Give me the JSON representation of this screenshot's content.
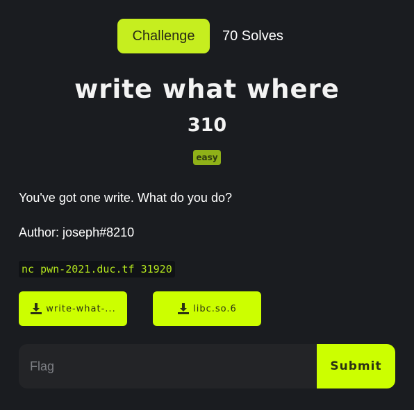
{
  "tabs": {
    "challenge_label": "Challenge",
    "solves_label": "70 Solves"
  },
  "challenge": {
    "name": "write what where",
    "points": "310",
    "difficulty": "easy",
    "description": "You've got one write. What do you do?",
    "author": "Author: joseph#8210",
    "connection": "nc pwn-2021.duc.tf 31920"
  },
  "files": [
    {
      "label": "write-what-...",
      "icon": "download-icon"
    },
    {
      "label": "libc.so.6",
      "icon": "download-icon"
    }
  ],
  "flag_form": {
    "placeholder": "Flag",
    "value": "",
    "submit_label": "Submit"
  },
  "colors": {
    "background": "#1a1c20",
    "accent": "#ccff00",
    "badge": "#8fb118",
    "code_text": "#b4e61e"
  }
}
